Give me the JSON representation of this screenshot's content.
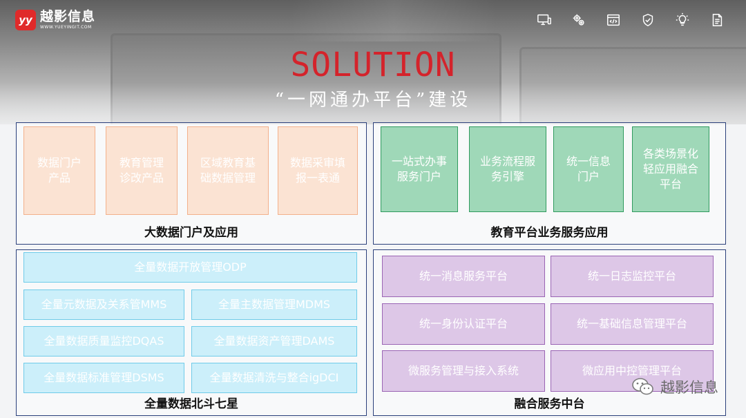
{
  "logo": {
    "mark": "yy",
    "name": "越影信息",
    "url": "WWW.YUEYINGIT.COM"
  },
  "top_icons": [
    "monitor-icon",
    "gears-icon",
    "code-window-icon",
    "shield-check-icon",
    "lightbulb-icon",
    "document-edit-icon"
  ],
  "title": "SOLUTION",
  "subtitle": "“一网通办平台”建设",
  "panels": {
    "big_data": {
      "label": "大数据门户及应用",
      "cards": [
        "数据门户\n产品",
        "教育管理\n诊改产品",
        "区域教育基\n础数据管理",
        "数据采审填\n报一表通"
      ]
    },
    "edu": {
      "label": "教育平台业务服务应用",
      "cards": [
        "一站式办事\n服务门户",
        "业务流程服\n务引擎",
        "统一信息\n门户",
        "各类场景化\n轻应用融合\n平台"
      ]
    },
    "full_data": {
      "label": "全量数据北斗七星",
      "top": "全量数据开放管理ODP",
      "cards": [
        "全量元数据及关系管MMS",
        "全量主数据管理MDMS",
        "全量数据质量监控DQAS",
        "全量数据资产管理DAMS",
        "全量数据标准管理DSMS",
        "全量数据清洗与整合igDCI"
      ]
    },
    "fusion": {
      "label": "融合服务中台",
      "cards": [
        "统一消息服务平台",
        "统一日志监控平台",
        "统一身份认证平台",
        "统一基础信息管理平台",
        "微服务管理与接入系统",
        "微应用中控管理平台"
      ]
    }
  },
  "watermark": {
    "icon": "wechat-icon",
    "text": "越影信息"
  },
  "colors": {
    "title_red": "#d4232b",
    "panel_border": "#2a3f7a",
    "orange": "#f3b08a",
    "green": "#2f9a5e",
    "cyan": "#6fcbe9",
    "purple": "#9a64b4"
  }
}
